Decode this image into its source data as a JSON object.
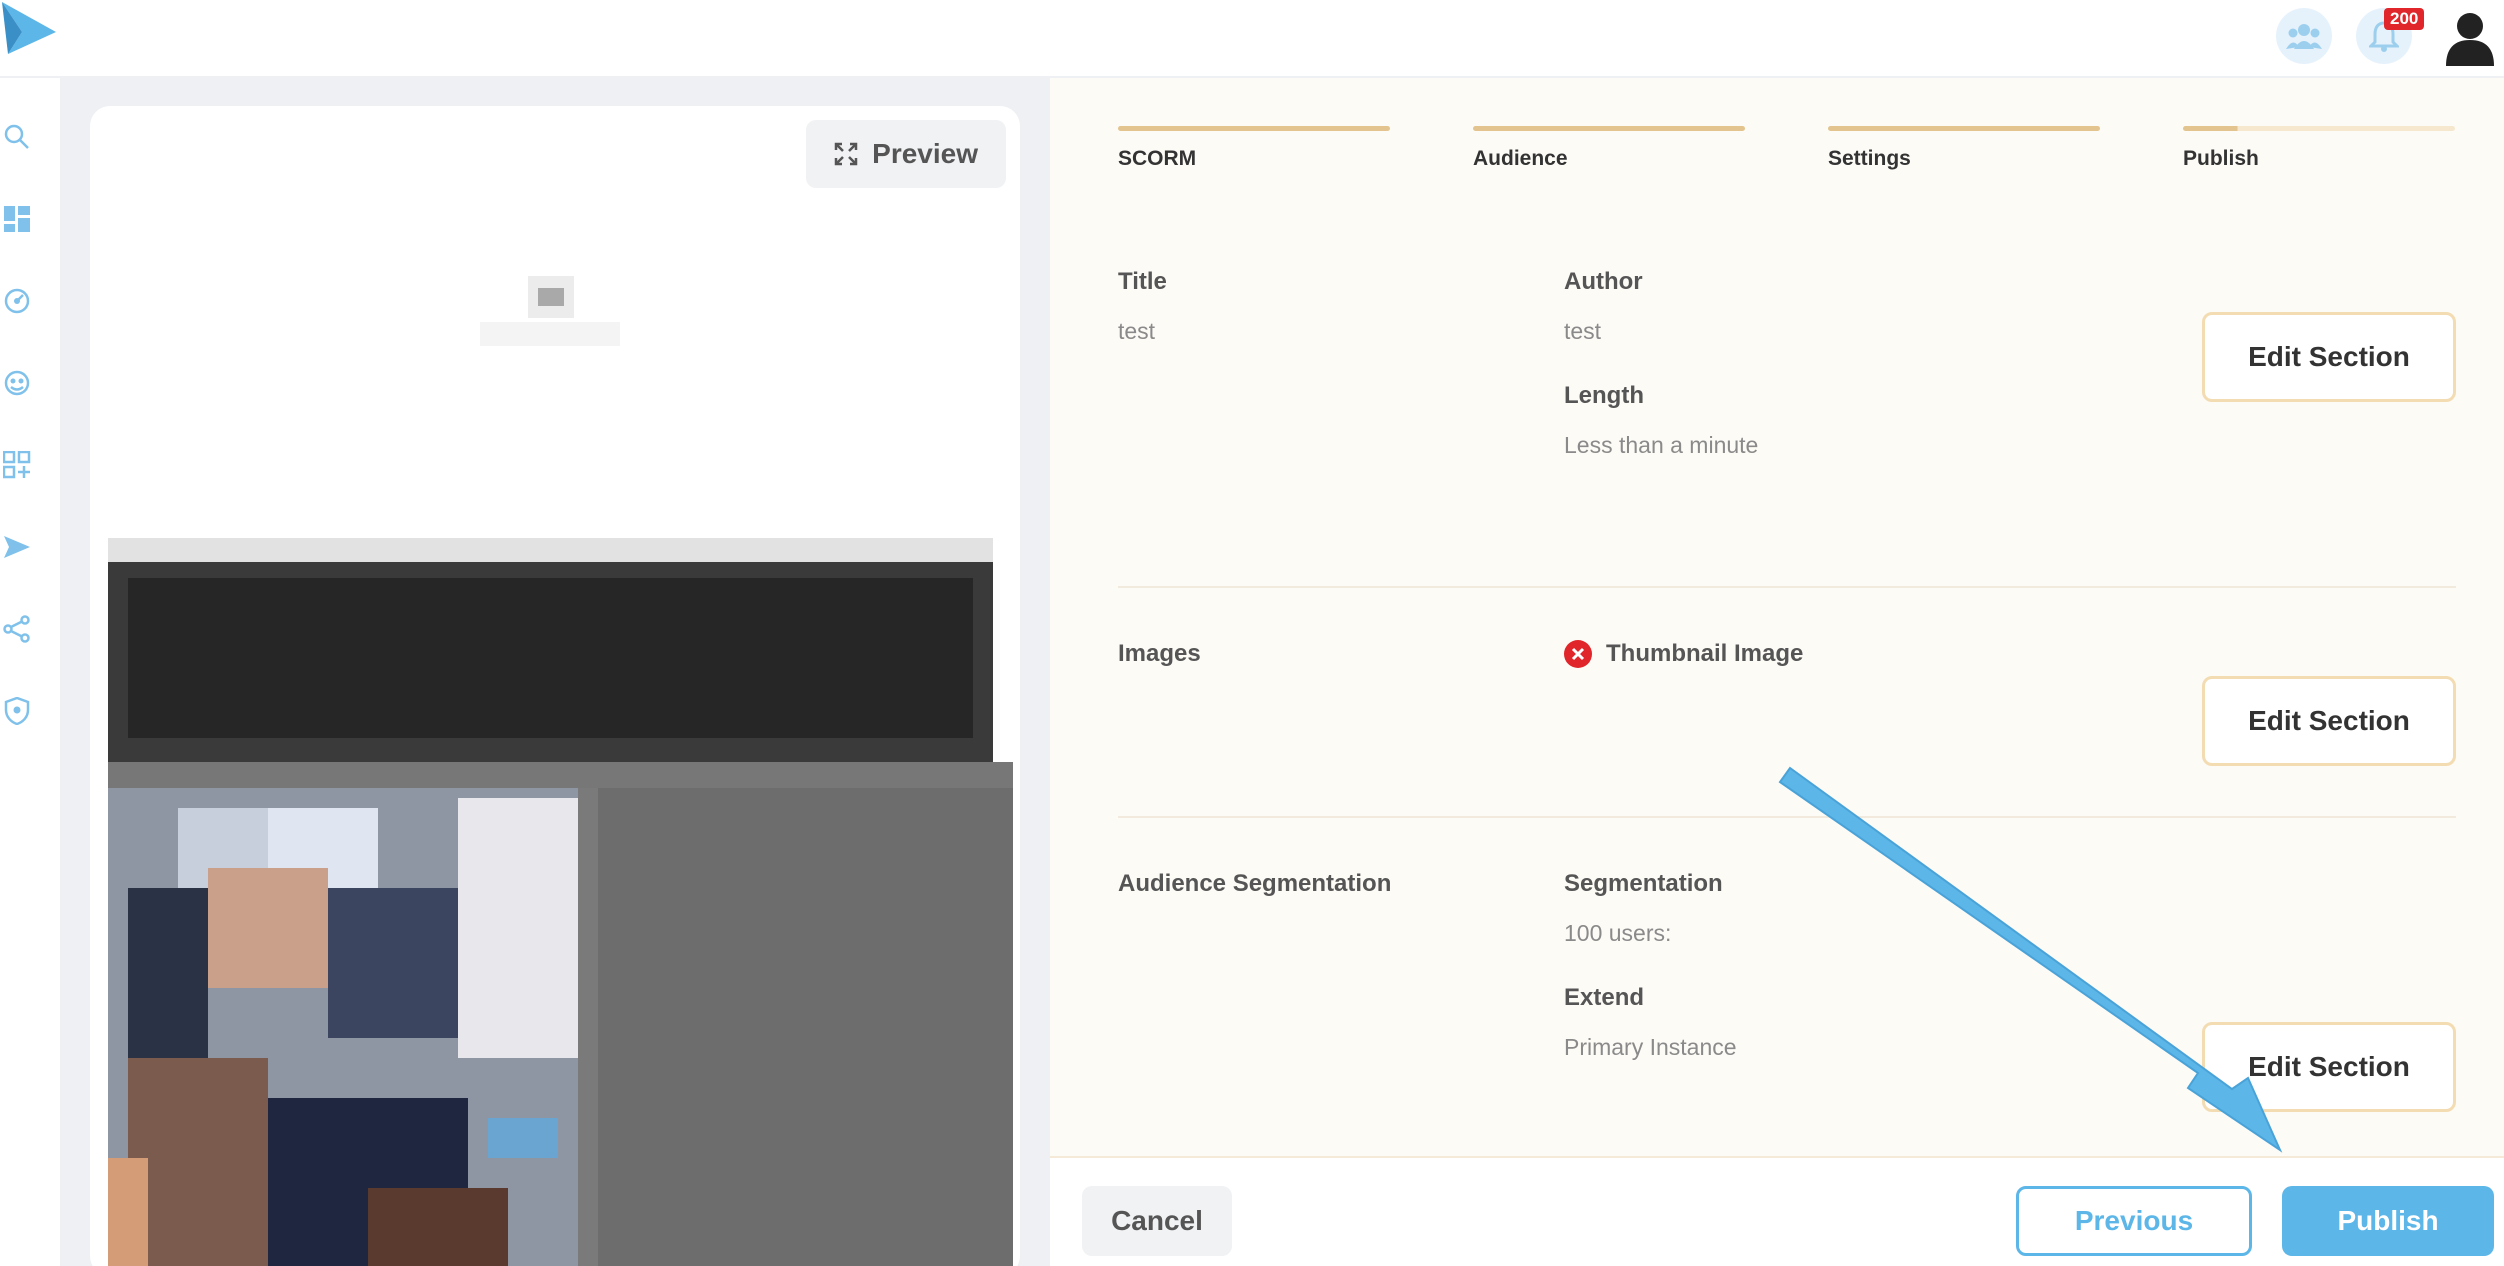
{
  "topbar": {
    "notification_count": "200",
    "icons": [
      "logo-icon",
      "team-icon",
      "bell-icon",
      "user-avatar-icon"
    ]
  },
  "leftnav": {
    "icons": [
      "search-icon",
      "dashboard-icon",
      "dial-icon",
      "support-icon",
      "add-app-icon",
      "send-icon",
      "share-icon",
      "shield-icon"
    ]
  },
  "preview": {
    "button_label": "Preview"
  },
  "steps": [
    {
      "label": "SCORM",
      "complete": true
    },
    {
      "label": "Audience",
      "complete": true
    },
    {
      "label": "Settings",
      "complete": true
    },
    {
      "label": "Publish",
      "complete": false,
      "progress": 0.2
    }
  ],
  "sections": {
    "details": {
      "title_label": "Title",
      "title_value": "test",
      "author_label": "Author",
      "author_value": "test",
      "length_label": "Length",
      "length_value": "Less than a minute",
      "edit_label": "Edit Section"
    },
    "images": {
      "title": "Images",
      "thumbnail_label": "Thumbnail Image",
      "thumbnail_status": "missing",
      "edit_label": "Edit Section"
    },
    "audience": {
      "title": "Audience Segmentation",
      "segmentation_label": "Segmentation",
      "segmentation_value": "100 users:",
      "extend_label": "Extend",
      "extend_value": "Primary Instance",
      "edit_label": "Edit Section"
    }
  },
  "footer": {
    "cancel_label": "Cancel",
    "previous_label": "Previous",
    "publish_label": "Publish"
  },
  "colors": {
    "accent_blue": "#5cb6e8",
    "step_gold": "#e3c48f",
    "error_red": "#e0262a",
    "content_bg": "#fdfbf6"
  }
}
